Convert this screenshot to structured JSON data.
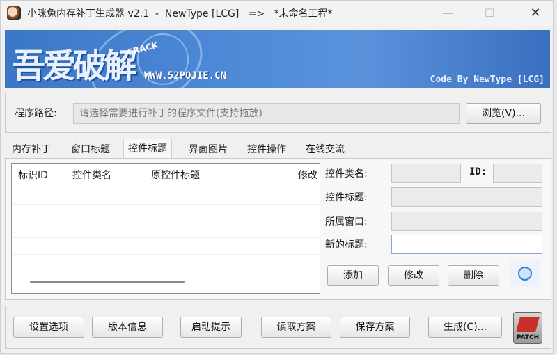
{
  "window": {
    "title": "小咪兔内存补丁生成器 v2.1  -  NewType [LCG]   =>   *未命名工程*",
    "minimize_glyph": "—",
    "maximize_glyph": "☐",
    "close_glyph": "✕"
  },
  "banner": {
    "logo_text": "吾爱破解",
    "crack_text": "CRACK",
    "url": "WWW.52POJIE.CN",
    "credit": "Code By NewType [LCG]"
  },
  "path": {
    "label": "程序路径:",
    "placeholder": "请选择需要进行补丁的程序文件(支持拖放)",
    "browse_label": "浏览(V)..."
  },
  "tabs": [
    {
      "label": "内存补丁"
    },
    {
      "label": "窗口标题"
    },
    {
      "label": "控件标题",
      "active": true
    },
    {
      "label": "界面图片"
    },
    {
      "label": "控件操作"
    },
    {
      "label": "在线交流"
    }
  ],
  "list": {
    "columns": [
      "标识ID",
      "控件类名",
      "原控件标题",
      "修改"
    ]
  },
  "form": {
    "class_label": "控件类名:",
    "id_label": "ID:",
    "title_label": "控件标题:",
    "window_label": "所属窗口:",
    "new_title_label": "新的标题:",
    "add_label": "添加",
    "modify_label": "修改",
    "delete_label": "删除"
  },
  "bottom": {
    "settings_label": "设置选项",
    "version_label": "版本信息",
    "startup_label": "启动提示",
    "load_label": "读取方案",
    "save_label": "保存方案",
    "generate_label": "生成(C)...",
    "patch_label": "PATCH"
  },
  "icons": {
    "app": "rabbit-icon",
    "online": "globe-icon",
    "patch": "patch-pen-icon"
  }
}
